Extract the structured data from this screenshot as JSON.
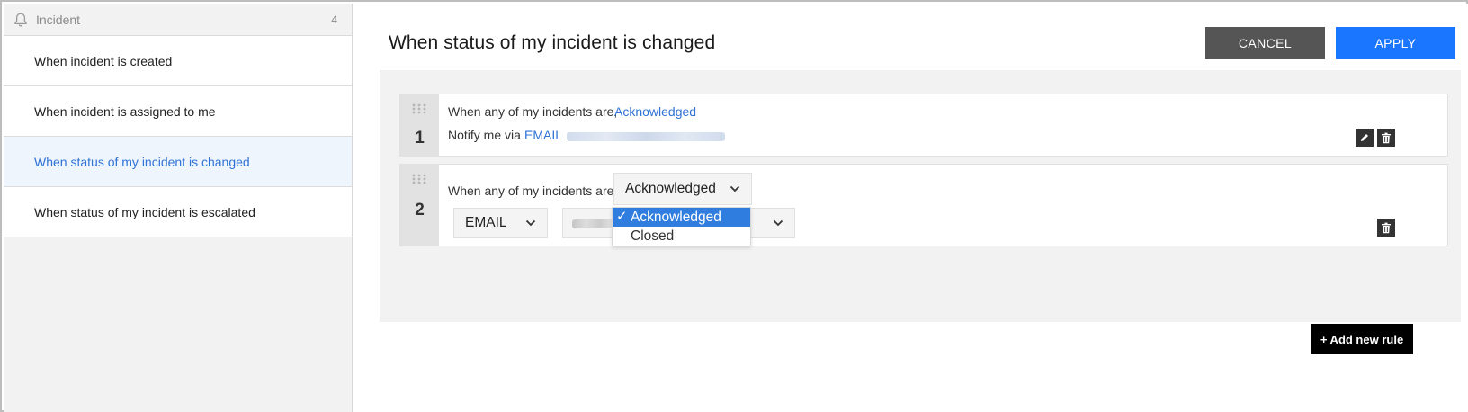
{
  "sidebar": {
    "header": {
      "label": "Incident",
      "count": "4",
      "icon": "bell-icon"
    },
    "items": [
      {
        "label": "When incident is created"
      },
      {
        "label": "When incident is assigned to me"
      },
      {
        "label": "When status of my incident is changed",
        "active": true
      },
      {
        "label": "When status of my incident is escalated"
      }
    ]
  },
  "main": {
    "title": "When status of my incident is changed",
    "cancel_label": "CANCEL",
    "apply_label": "APPLY"
  },
  "rules": [
    {
      "number": "1",
      "condition_text": "When any of my incidents are,",
      "condition_value": "Acknowledged",
      "notify_text": "Notify me via",
      "notify_channel": "EMAIL"
    },
    {
      "number": "2",
      "condition_text": "When any of my incidents are",
      "status_select_value": "Acknowledged",
      "channel_select_value": "EMAIL"
    }
  ],
  "status_dropdown": {
    "check": "✓",
    "options": [
      "Acknowledged",
      "Closed"
    ],
    "selected": "Acknowledged"
  },
  "add_rule_label": "+ Add new rule",
  "colors": {
    "accent": "#1a75ff",
    "link": "#2f73d6",
    "cancel": "#555555",
    "selected_option": "#2f7ddf"
  }
}
